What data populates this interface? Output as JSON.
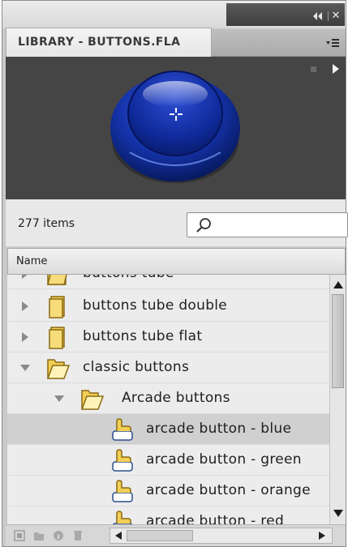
{
  "panel": {
    "tab_title": "LIBRARY - BUTTONS.FLA",
    "item_count": "277 items",
    "search": {
      "value": "",
      "placeholder": ""
    },
    "column_header": "Name"
  },
  "tree": [
    {
      "label": "buttons tube",
      "type": "folder",
      "state": "collapsed",
      "depth": 0
    },
    {
      "label": "buttons tube double",
      "type": "folder",
      "state": "collapsed",
      "depth": 0
    },
    {
      "label": "buttons tube flat",
      "type": "folder",
      "state": "collapsed",
      "depth": 0
    },
    {
      "label": "classic buttons",
      "type": "folder",
      "state": "expanded",
      "depth": 0
    },
    {
      "label": "Arcade buttons",
      "type": "folder",
      "state": "expanded",
      "depth": 1
    },
    {
      "label": "arcade button - blue",
      "type": "button-symbol",
      "depth": 2,
      "selected": true
    },
    {
      "label": "arcade button - green",
      "type": "button-symbol",
      "depth": 2
    },
    {
      "label": "arcade button - orange",
      "type": "button-symbol",
      "depth": 2
    },
    {
      "label": "arcade button - red",
      "type": "button-symbol",
      "depth": 2
    }
  ],
  "icons": {
    "collapse": "double-chevron-left-icon",
    "close": "close-icon",
    "panel_menu": "panel-menu-icon",
    "play": "play-icon",
    "search": "search-icon",
    "folder": "folder-icon",
    "button_symbol": "button-symbol-icon"
  },
  "colors": {
    "preview_bg": "#454545",
    "button_blue": "#1535b8",
    "selected_row": "#d0d0d0",
    "folder_yellow": "#f2cf55"
  }
}
